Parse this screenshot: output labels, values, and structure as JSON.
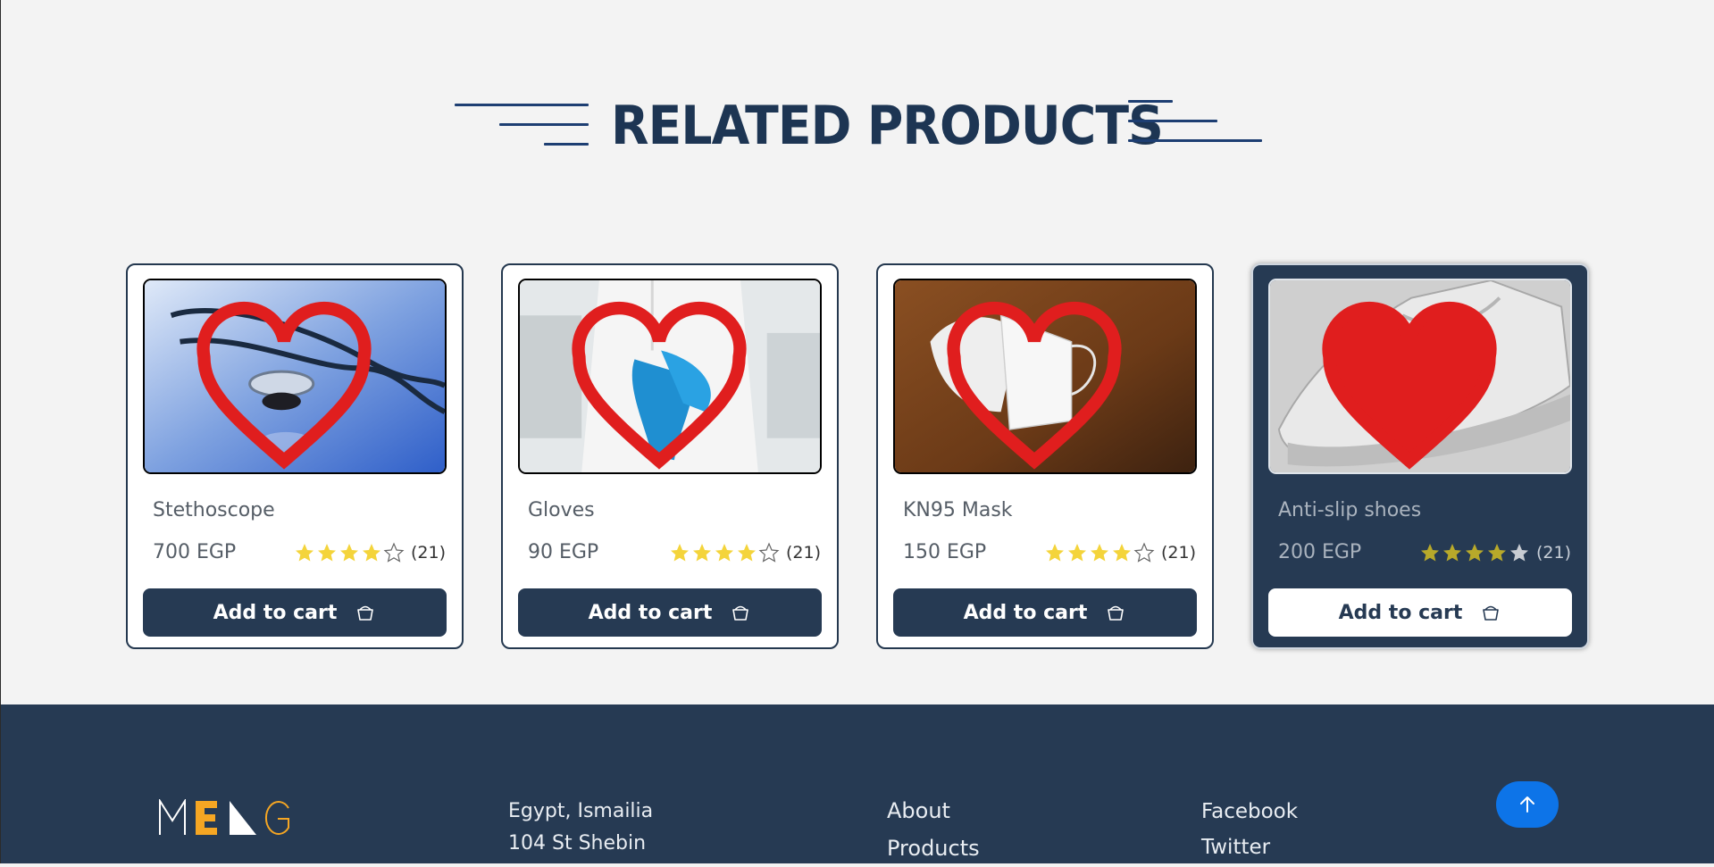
{
  "section": {
    "title": "RELATED PRODUCTS"
  },
  "products": [
    {
      "name": "Stethoscope",
      "price": "700 EGP",
      "rating": 4,
      "reviews": "(21)",
      "favorited": false,
      "cart_label": "Add to cart",
      "image": "stethoscope"
    },
    {
      "name": "Gloves",
      "price": "90 EGP",
      "rating": 4,
      "reviews": "(21)",
      "favorited": false,
      "cart_label": "Add to cart",
      "image": "gloves"
    },
    {
      "name": "KN95 Mask",
      "price": "150 EGP",
      "rating": 4,
      "reviews": "(21)",
      "favorited": false,
      "cart_label": "Add to cart",
      "image": "kn95-mask"
    },
    {
      "name": "Anti-slip shoes",
      "price": "200 EGP",
      "rating": 4,
      "reviews": "(21)",
      "favorited": true,
      "cart_label": "Add to cart",
      "image": "anti-slip-shoes",
      "active": true
    }
  ],
  "footer": {
    "logo_text": "MENG",
    "address": [
      "Egypt, Ismailia",
      "104 St Shebin"
    ],
    "links": [
      "About",
      "Products"
    ],
    "social": [
      "Facebook",
      "Twitter"
    ],
    "scroll_top_icon": "arrow-up-icon"
  },
  "colors": {
    "primary": "#263a53",
    "star": "#f4d43b",
    "star_active": "#b8a92a",
    "heart": "#e01e1e",
    "accent_blue": "#0d74e8",
    "logo_orange": "#f5a623"
  }
}
